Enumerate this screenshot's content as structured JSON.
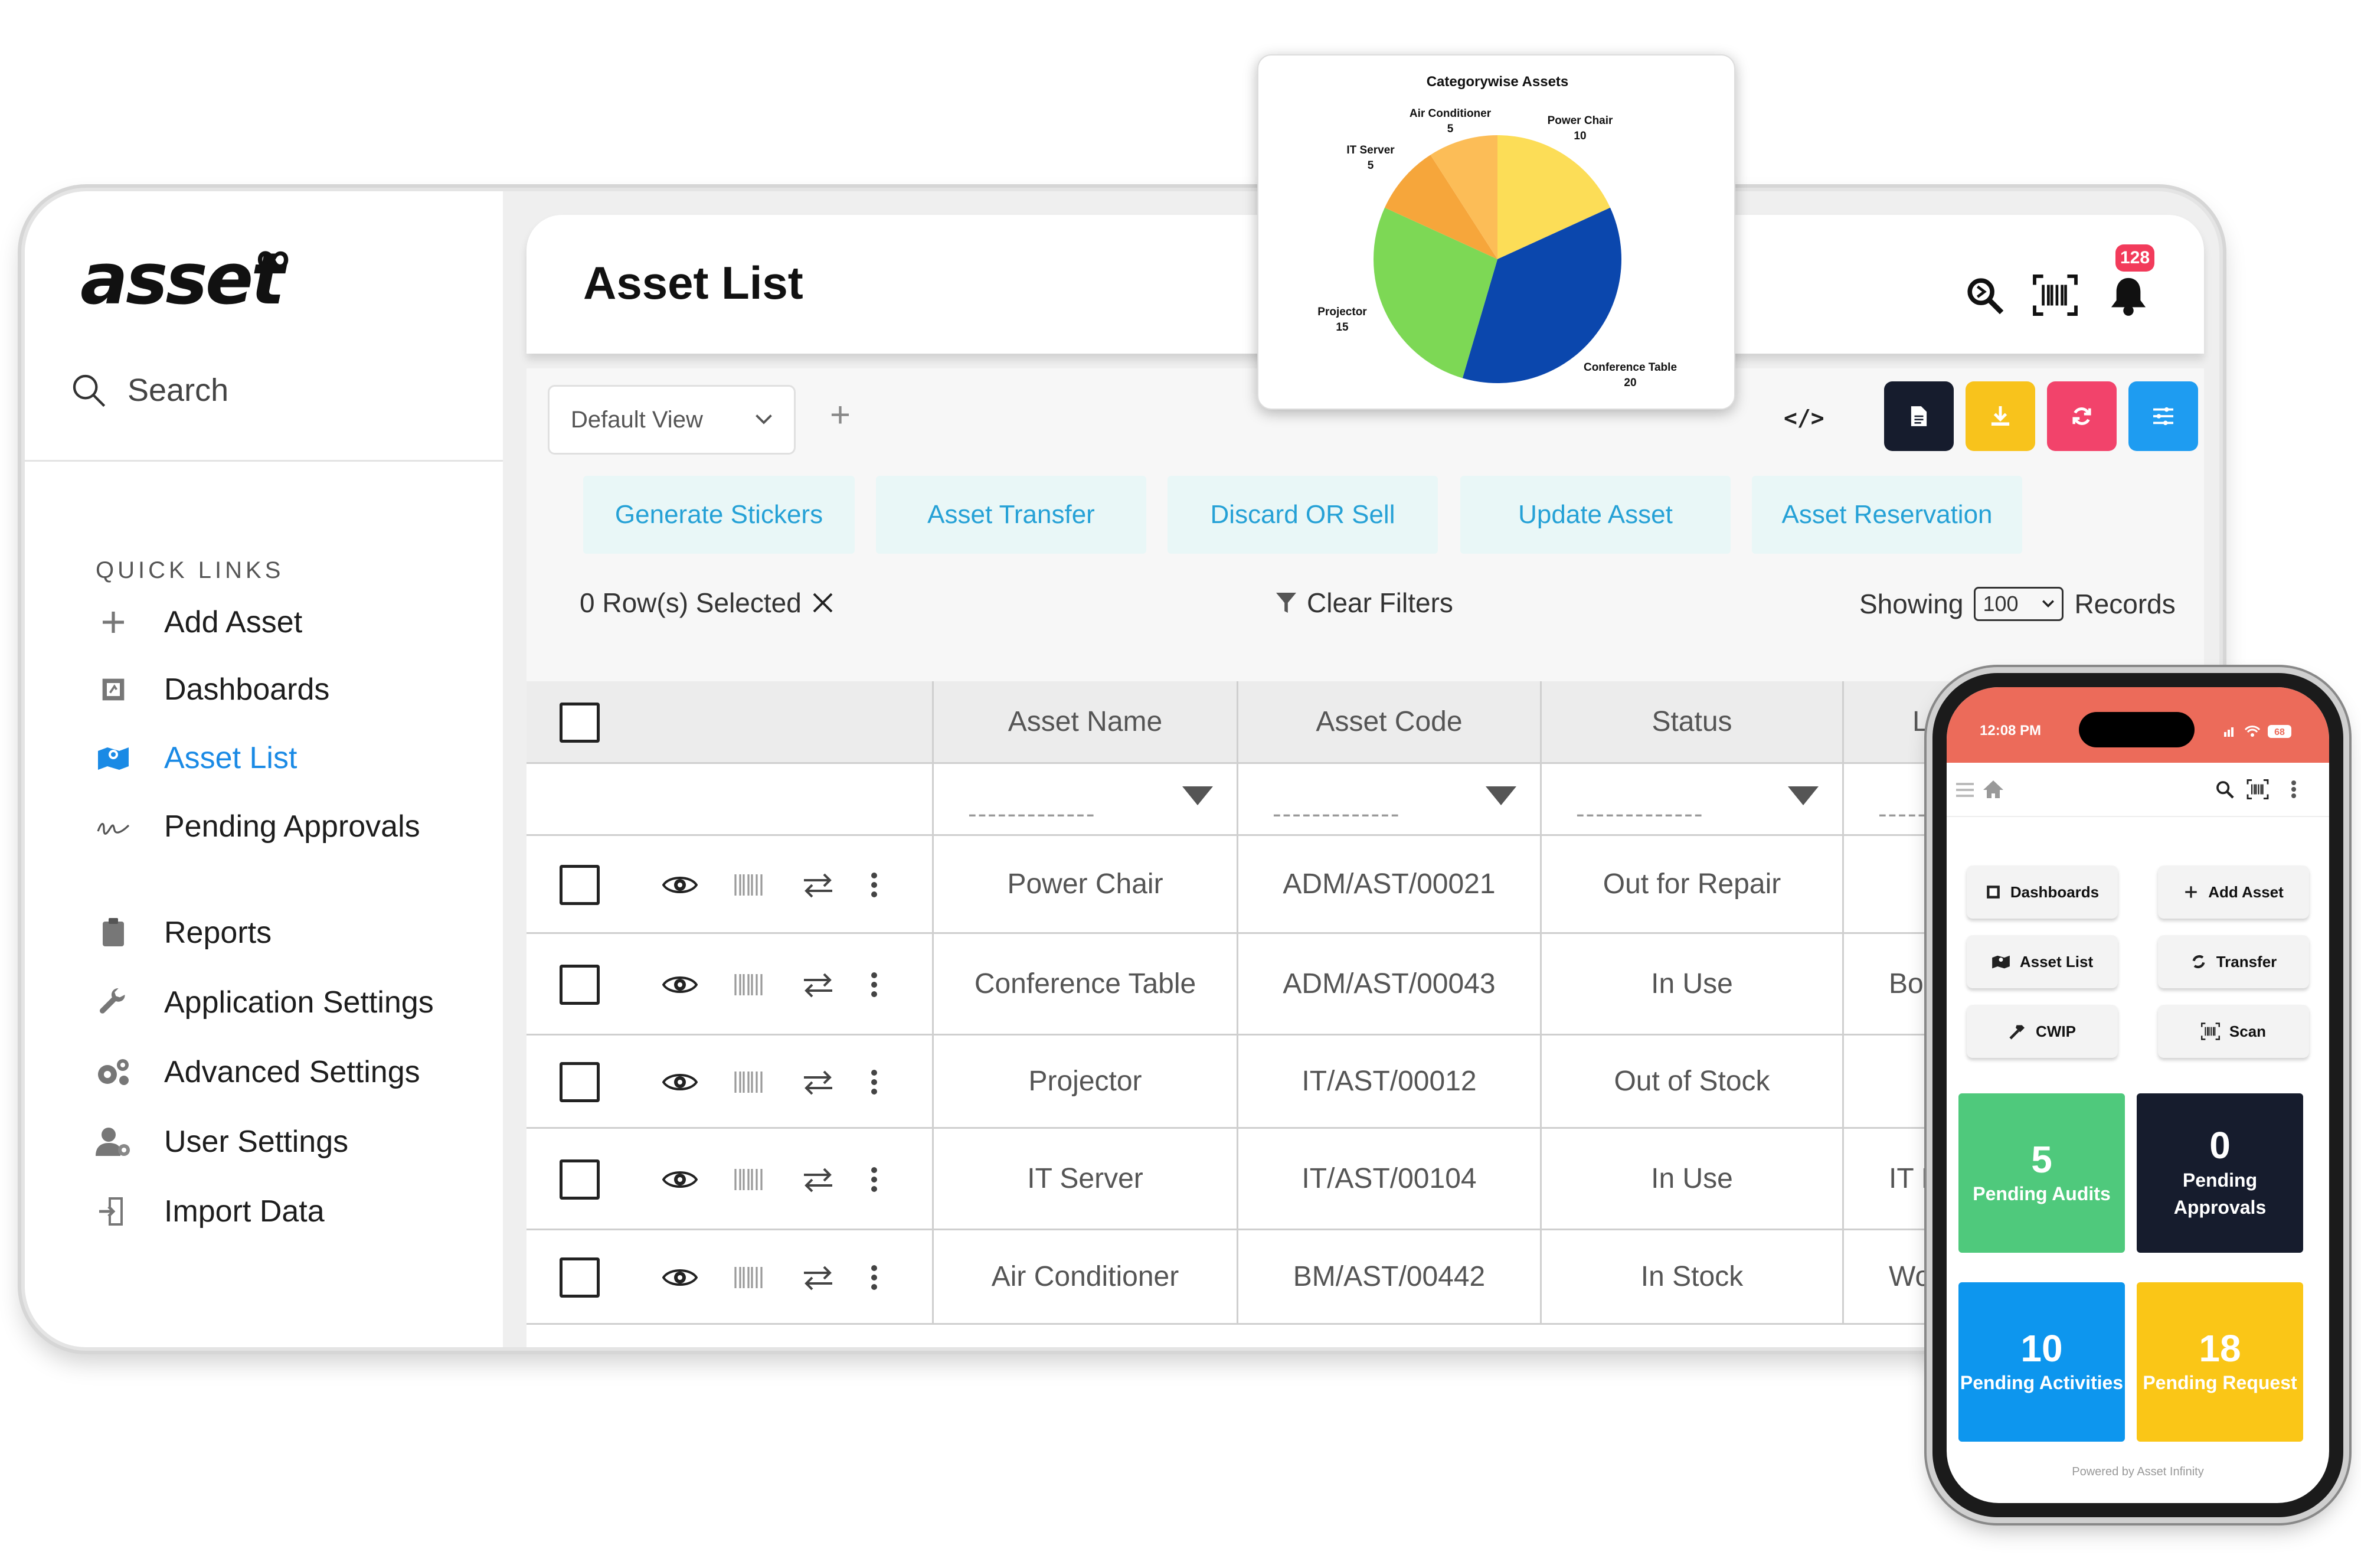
{
  "sidebar": {
    "logo": "asset",
    "search_label": "Search",
    "quick_links_title": "QUICK LINKS",
    "items": [
      {
        "label": "Add Asset",
        "icon": "plus-icon"
      },
      {
        "label": "Dashboards",
        "icon": "dashboard-icon"
      },
      {
        "label": "Asset List",
        "icon": "map-icon",
        "active": true
      },
      {
        "label": "Pending Approvals",
        "icon": "signature-icon"
      },
      {
        "label": "Reports",
        "icon": "clipboard-icon"
      },
      {
        "label": "Application Settings",
        "icon": "wrench-icon"
      },
      {
        "label": "Advanced Settings",
        "icon": "gears-icon"
      },
      {
        "label": "User Settings",
        "icon": "user-gear-icon"
      },
      {
        "label": "Import Data",
        "icon": "import-icon"
      }
    ]
  },
  "header": {
    "title": "Asset List",
    "notification_count": "128"
  },
  "toolbar": {
    "view_select": "Default View",
    "actions": [
      "Generate Stickers",
      "Asset Transfer",
      "Discard OR Sell",
      "Update Asset",
      "Asset Reservation"
    ],
    "rows_selected": "0 Row(s) Selected",
    "clear_filters": "Clear Filters",
    "showing_label": "Showing",
    "records_value": "100",
    "records_label": "Records",
    "colors": {
      "dark": "#161c2d",
      "yellow": "#f8c31c",
      "pink": "#f2436b",
      "blue": "#1e9cf1"
    }
  },
  "table": {
    "columns": [
      "Asset Name",
      "Asset Code",
      "Status",
      "Lo"
    ],
    "filter_placeholder": "-------------",
    "rows": [
      {
        "name": "Power Chair",
        "code": "ADM/AST/00021",
        "status": "Out for Repair",
        "loc": ""
      },
      {
        "name": "Conference Table",
        "code": "ADM/AST/00043",
        "status": "In Use",
        "loc": "Boa"
      },
      {
        "name": "Projector",
        "code": "IT/AST/00012",
        "status": "Out of Stock",
        "loc": ""
      },
      {
        "name": "IT Server",
        "code": "IT/AST/00104",
        "status": "In Use",
        "loc": "IT F"
      },
      {
        "name": "Air Conditioner",
        "code": "BM/AST/00442",
        "status": "In Stock",
        "loc": "Wo"
      }
    ]
  },
  "chart_data": {
    "type": "pie",
    "title": "Categorywise Assets",
    "slices": [
      {
        "label": "Power Chair",
        "value": 10,
        "color": "#fcdd57"
      },
      {
        "label": "Conference Table",
        "value": 20,
        "color": "#0b47ad"
      },
      {
        "label": "Projector",
        "value": 15,
        "color": "#7dd855"
      },
      {
        "label": "IT Server",
        "value": 5,
        "color": "#f6a63b"
      },
      {
        "label": "Air Conditioner",
        "value": 5,
        "color": "#fcbd57"
      }
    ]
  },
  "phone": {
    "time": "12:08 PM",
    "battery": "68",
    "buttons": [
      {
        "label": "Dashboards",
        "icon": "dashboard-icon"
      },
      {
        "label": "Add Asset",
        "icon": "plus-icon"
      },
      {
        "label": "Asset List",
        "icon": "map-icon"
      },
      {
        "label": "Transfer",
        "icon": "transfer-icon"
      },
      {
        "label": "CWIP",
        "icon": "hammer-icon"
      },
      {
        "label": "Scan",
        "icon": "scan-icon"
      }
    ],
    "tiles": [
      {
        "num": "5",
        "label": "Pending Audits",
        "color": "#4fc97c"
      },
      {
        "num": "0",
        "label": "Pending Approvals",
        "color": "#161c2d"
      },
      {
        "num": "10",
        "label": "Pending Activities",
        "color": "#0d96ee"
      },
      {
        "num": "18",
        "label": "Pending Request",
        "color": "#fac617"
      }
    ],
    "powered_by": "Powered by Asset Infinity"
  }
}
